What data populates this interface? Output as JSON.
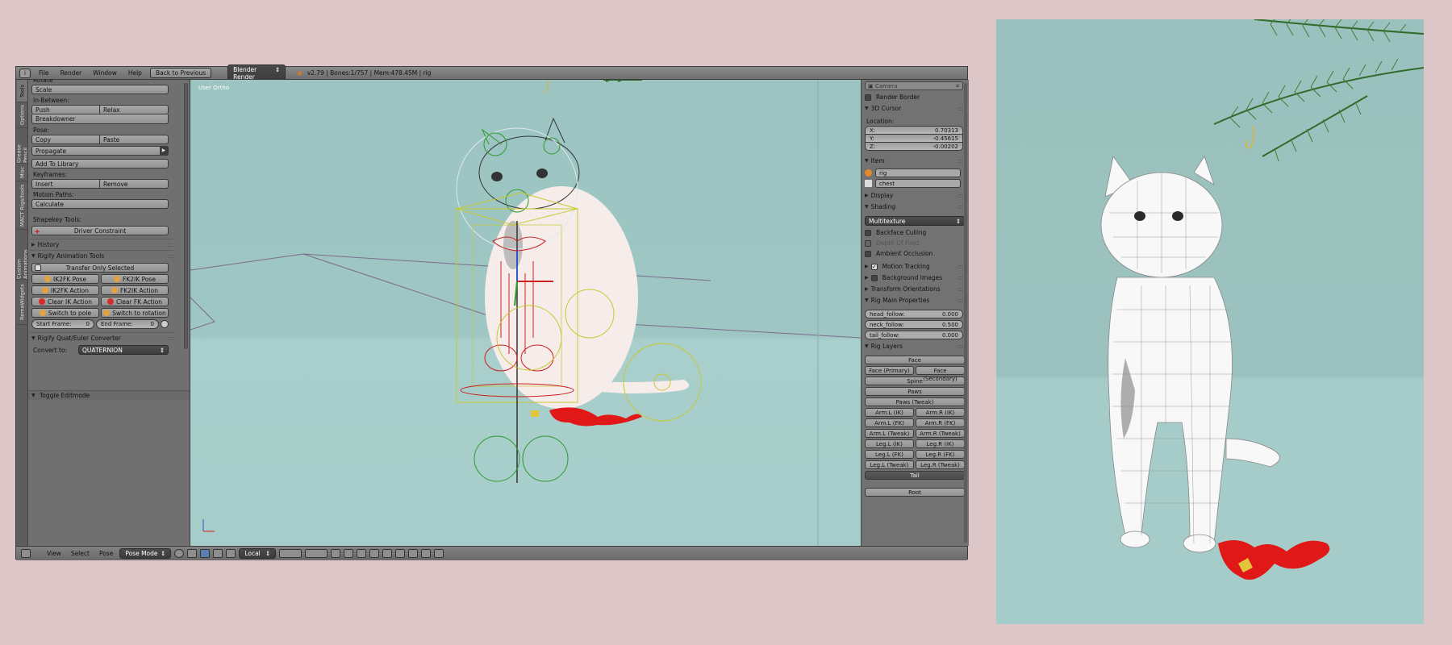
{
  "header": {
    "menus": [
      "File",
      "Render",
      "Window",
      "Help"
    ],
    "back_button": "Back to Previous",
    "engine": "Blender Render",
    "stats": "v2.79 | Bones:1/757 | Mem:478.45M | rig"
  },
  "tabs": [
    "Tools",
    "Options",
    "Grease Pencil",
    "Misc",
    "MACT Rigs/tools",
    "Custom Animations",
    "RemaWidgets"
  ],
  "shelf": {
    "rotate_label": "Rotate",
    "scale": "Scale",
    "inbetween_label": "In-Between:",
    "push": "Push",
    "relax": "Relax",
    "breakdowner": "Breakdowner",
    "pose_label": "Pose:",
    "copy": "Copy",
    "paste": "Paste",
    "propagate": "Propagate",
    "add_to_library": "Add To Library",
    "keyframes_label": "Keyframes:",
    "insert": "Insert",
    "remove": "Remove",
    "motion_paths_label": "Motion Paths:",
    "calculate": "Calculate",
    "shapekey_label": "Shapekey Tools:",
    "driver_constraint": "Driver Constraint",
    "history": "History",
    "rigify_tools": "Rigify Animation Tools",
    "transfer_only_selected": "Transfer Only Selected",
    "ik2fk_pose": "IK2FK Pose",
    "fk2ik_pose": "FK2IK Pose",
    "ik2fk_action": "IK2FK Action",
    "fk2ik_action": "FK2IK Action",
    "clear_ik_action": "Clear IK Action",
    "clear_fk_action": "Clear FK Action",
    "switch_to_pole": "Switch to pole",
    "switch_to_rotation": "Switch to rotation",
    "start_frame_label": "Start Frame:",
    "start_frame_value": "0",
    "end_frame_label": "End Frame:",
    "end_frame_value": "0",
    "quat_converter": "Rigify Quat/Euler Converter",
    "convert_to_label": "Convert to:",
    "convert_to_value": "QUATERNION",
    "toggle_editmode": "Toggle Editmode"
  },
  "viewport": {
    "label": "User Ortho"
  },
  "props": {
    "camera": "Camera",
    "render_border": "Render Border",
    "cursor_header": "3D Cursor",
    "location_label": "Location:",
    "x_label": "X:",
    "x_value": "0.70313",
    "y_label": "Y:",
    "y_value": "-0.45615",
    "z_label": "Z:",
    "z_value": "-0.00202",
    "item_header": "Item",
    "item_name": "rig",
    "bone_name": "chest",
    "display_header": "Display",
    "shading_header": "Shading",
    "shading_mode": "Multitexture",
    "backface_culling": "Backface Culling",
    "depth_of_field": "Depth Of Field",
    "ambient_occlusion": "Ambient Occlusion",
    "motion_tracking": "Motion Tracking",
    "background_images": "Background Images",
    "transform_orientations": "Transform Orientations",
    "rig_main_props": "Rig Main Properties",
    "head_follow_label": "head_follow:",
    "head_follow_value": "0.000",
    "neck_follow_label": "neck_follow:",
    "neck_follow_value": "0.500",
    "tail_follow_label": "tail_follow:",
    "tail_follow_value": "0.000",
    "rig_layers": "Rig Layers",
    "layers": {
      "face": "Face",
      "face_primary": "Face (Primary)",
      "face_secondary": "Face (Secondary)",
      "spine": "Spine",
      "paws": "Paws",
      "paws_tweak": "Paws (Tweak)",
      "arm_l_ik": "Arm.L (IK)",
      "arm_r_ik": "Arm.R (IK)",
      "arm_l_fk": "Arm.L (FK)",
      "arm_r_fk": "Arm.R (FK)",
      "arm_l_tweak": "Arm.L (Tweak)",
      "arm_r_tweak": "Arm.R (Tweak)",
      "leg_l_ik": "Leg.L (IK)",
      "leg_r_ik": "Leg.R (IK)",
      "leg_l_fk": "Leg.L (FK)",
      "leg_r_fk": "Leg.R (FK)",
      "leg_l_tweak": "Leg.L (Tweak)",
      "leg_r_tweak": "Leg.R (Tweak)",
      "tail": "Tail",
      "root": "Root"
    }
  },
  "bottom": {
    "view": "View",
    "select": "Select",
    "pose": "Pose",
    "mode": "Pose Mode",
    "orientation": "Local"
  },
  "colors": {
    "viewport_bg": "#9ec6c3",
    "rig_red": "#cc2222",
    "rig_green": "#2f9a2f",
    "rig_yellow": "#c8c832",
    "leaves_red": "#e01818",
    "pine": "#2f6b2a"
  }
}
